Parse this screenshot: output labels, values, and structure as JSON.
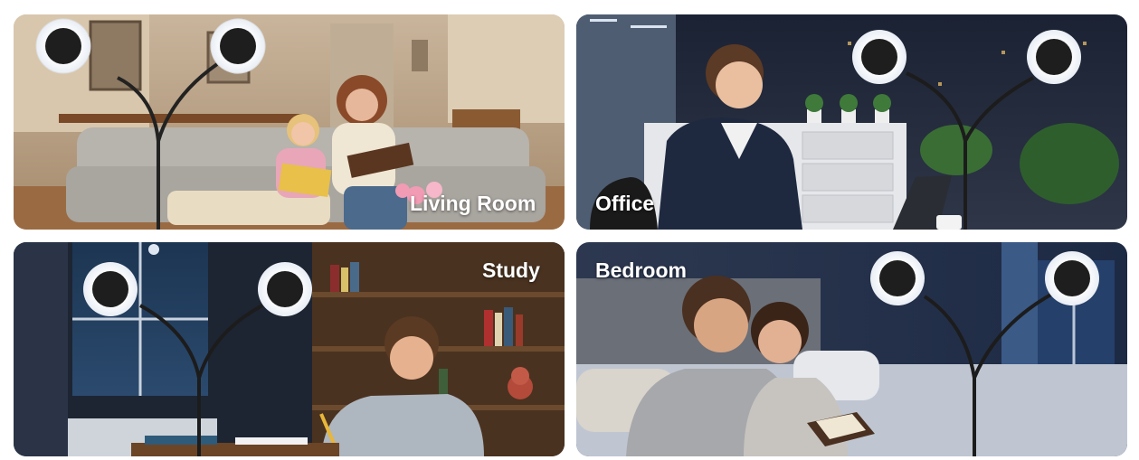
{
  "panels": {
    "living_room": {
      "label": "Living Room"
    },
    "office": {
      "label": "Office"
    },
    "study": {
      "label": "Study"
    },
    "bedroom": {
      "label": "Bedroom"
    }
  },
  "icons": {
    "lamp": "ring-fan-floor-lamp-icon"
  }
}
